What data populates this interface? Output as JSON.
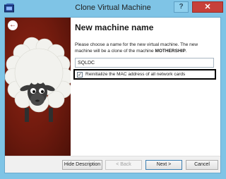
{
  "window": {
    "title": "Clone Virtual Machine",
    "help_label": "?",
    "close_label": "✕",
    "back_label": "←"
  },
  "page": {
    "title": "New machine name",
    "description_part1": "Please choose a name for the new virtual machine. The new machine will be a clone of the machine ",
    "source_machine": "MOTHERSHIP",
    "description_part2": ".",
    "name_value": "SQLDC",
    "mac_checkbox_checked": true,
    "mac_checkbox_mark": "✓",
    "mac_checkbox_label": "Reinitialize the MAC address of all network cards"
  },
  "buttons": {
    "hide_description": "Hide Description",
    "back": "< Back",
    "next": "Next >",
    "cancel": "Cancel"
  },
  "colors": {
    "title_bar": "#7fc4e6",
    "side_panel": "#8e2313",
    "close_button": "#c7403a"
  }
}
